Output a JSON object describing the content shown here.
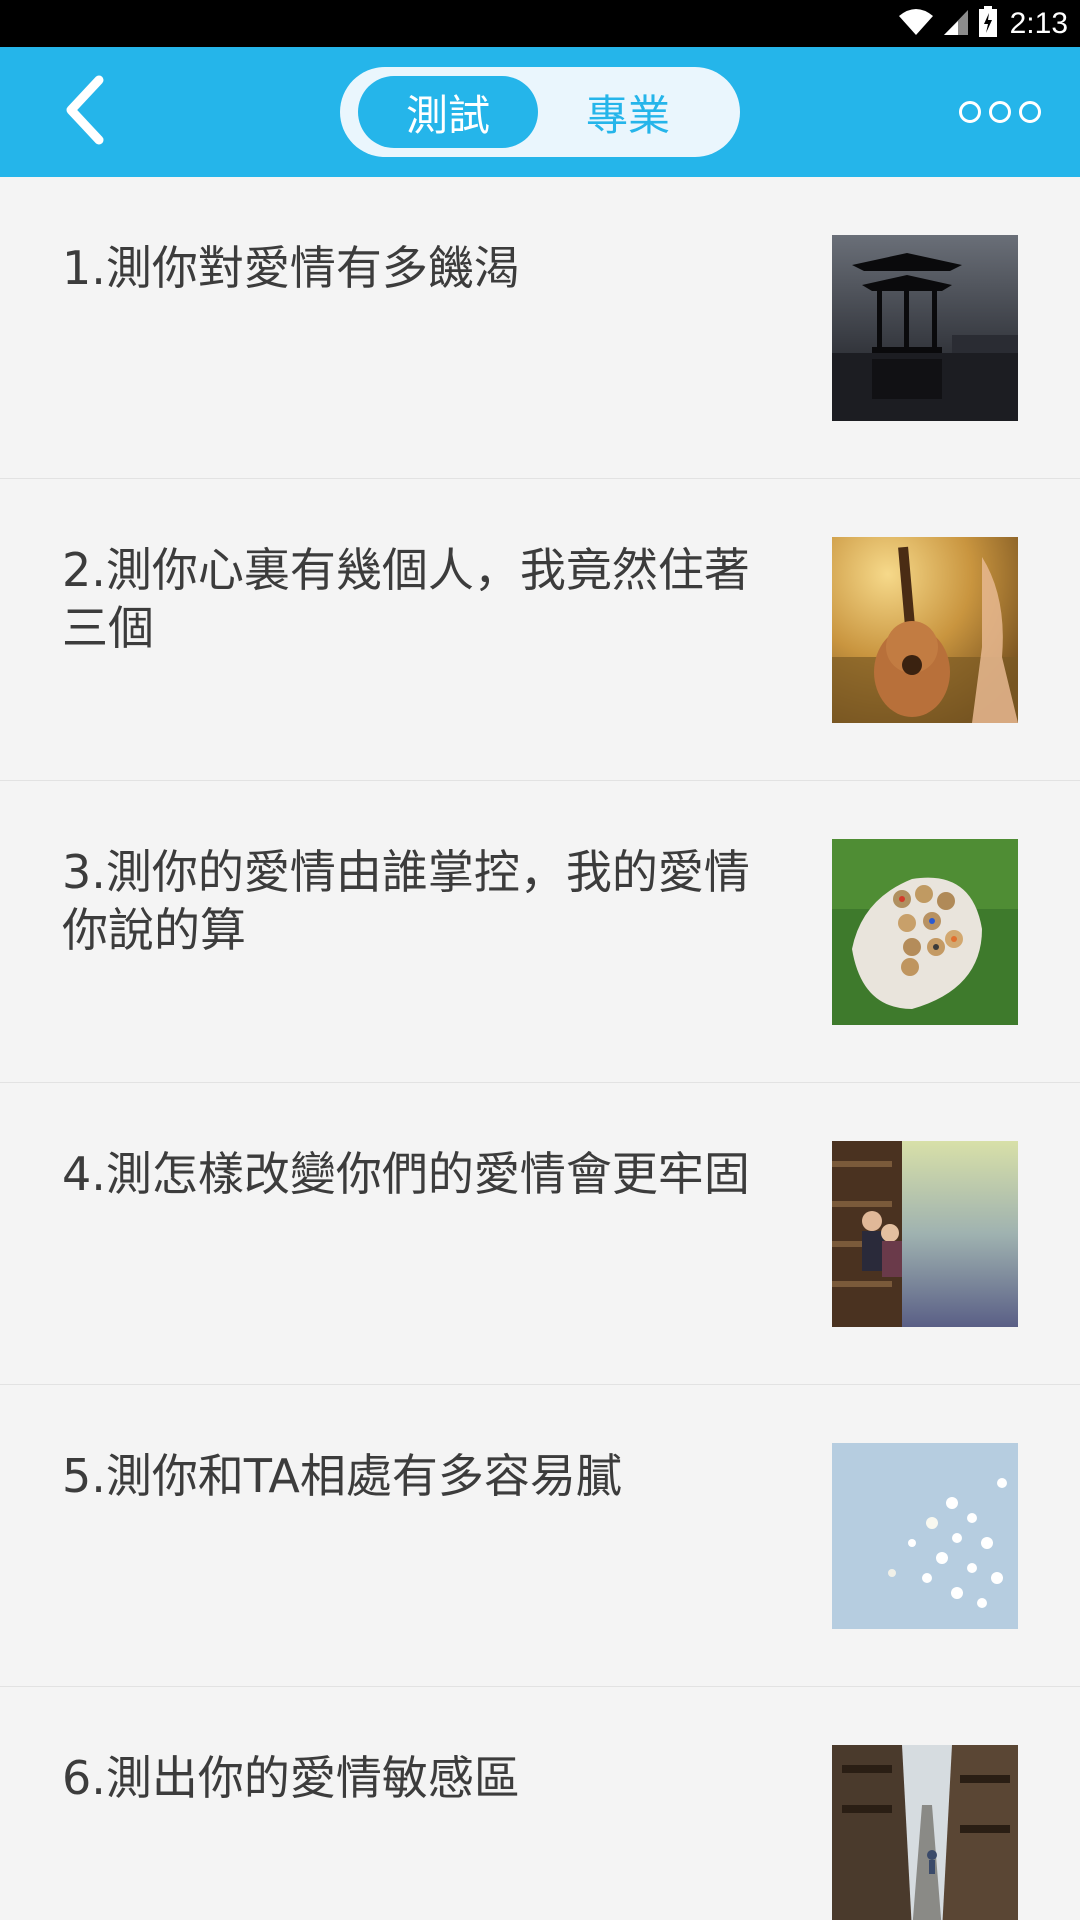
{
  "status_bar": {
    "time": "2:13"
  },
  "header": {
    "tabs": [
      {
        "label": "測試",
        "active": true
      },
      {
        "label": "專業",
        "active": false
      }
    ]
  },
  "colors": {
    "accent": "#25b5ea",
    "background": "#f4f4f4",
    "text": "#3c3c3c"
  },
  "list": {
    "items": [
      {
        "title": "1.測你對愛情有多饑渴",
        "thumbnail": "pavilion-silhouette"
      },
      {
        "title": "2.測你心裏有幾個人，我竟然住著三個",
        "thumbnail": "guitar-sunset"
      },
      {
        "title": "3.測你的愛情由誰掌控，我的愛情你說的算",
        "thumbnail": "colored-pencils-hand"
      },
      {
        "title": "4.測怎樣改變你們的愛情會更牢固",
        "thumbnail": "couple-by-water"
      },
      {
        "title": "5.測你和TA相處有多容易膩",
        "thumbnail": "white-flowers"
      },
      {
        "title": "6.測出你的愛情敏感區",
        "thumbnail": "narrow-street"
      }
    ]
  }
}
